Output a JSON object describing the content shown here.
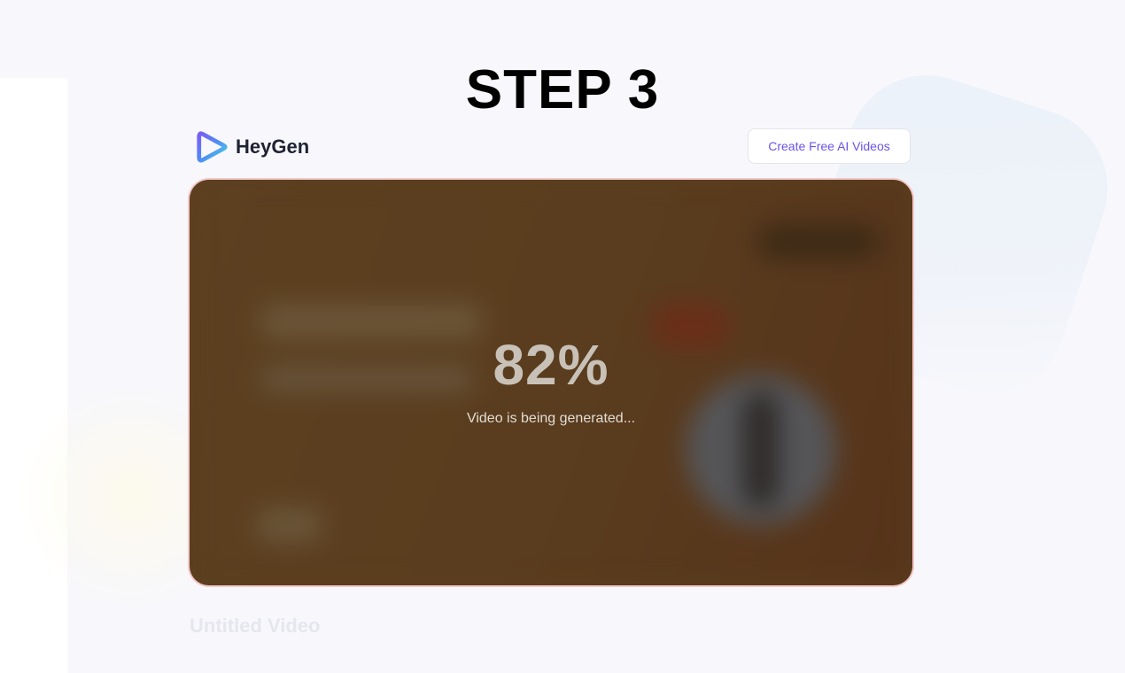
{
  "heading": "STEP 3",
  "header": {
    "brand_name": "HeyGen",
    "logo_icon": "heygen-play-logo",
    "cta_label": "Create Free AI Videos"
  },
  "video": {
    "progress_text": "82%",
    "progress_value": 0.82,
    "status_text": "Video is being generated..."
  },
  "title": "Untitled Video",
  "colors": {
    "accent": "#6b54e8",
    "frame_overlay": "#5b3f1f"
  }
}
